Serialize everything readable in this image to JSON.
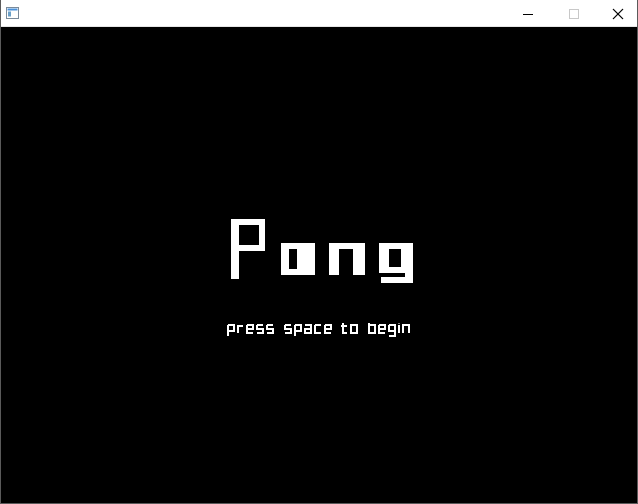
{
  "window": {
    "title": "",
    "controls": {
      "minimize_icon": "minimize-icon",
      "maximize_icon": "maximize-icon",
      "close_icon": "close-icon"
    }
  },
  "game": {
    "title": "Pong",
    "prompt": "press space to begin",
    "colors": {
      "background": "#000000",
      "text": "#ffffff"
    }
  }
}
